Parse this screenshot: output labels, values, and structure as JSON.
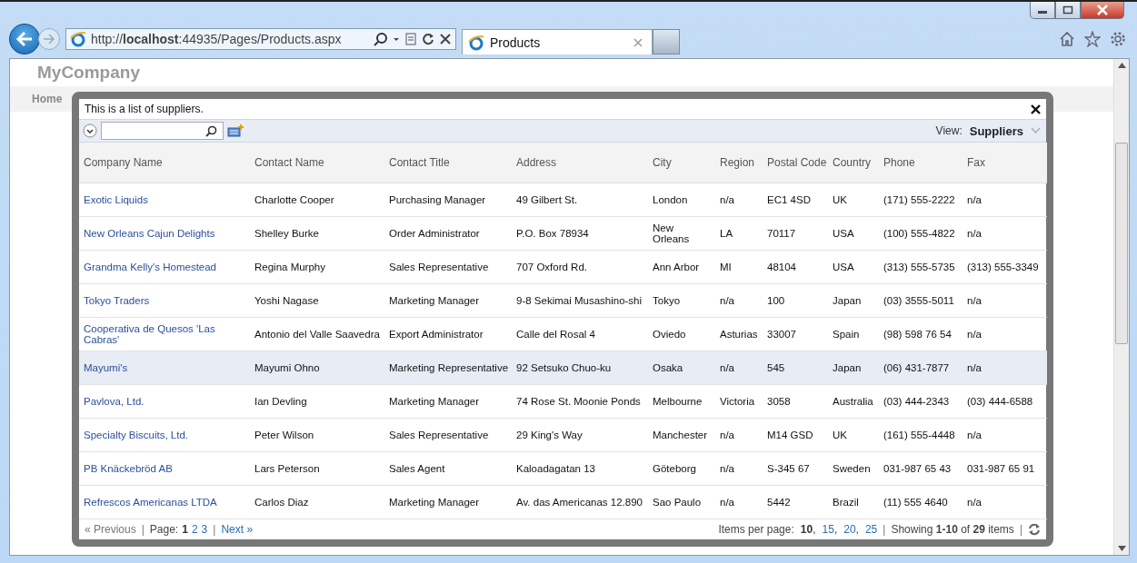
{
  "browser": {
    "address": "http://**localhost**:44935/Pages/Products.aspx",
    "tab": {
      "title": "Products",
      "selected": true
    }
  },
  "page": {
    "brand": "MyCompany",
    "nav": "Home"
  },
  "modal": {
    "description": "This is a list of suppliers.",
    "view": {
      "label": "View:",
      "value": "Suppliers"
    },
    "columns": [
      "Company Name",
      "Contact Name",
      "Contact Title",
      "Address",
      "City",
      "Region",
      "Postal Code",
      "Country",
      "Phone",
      "Fax"
    ],
    "rows": [
      {
        "selected": false,
        "cells": [
          "Exotic Liquids",
          "Charlotte Cooper",
          "Purchasing Manager",
          "49 Gilbert St.",
          "London",
          "n/a",
          "EC1 4SD",
          "UK",
          "(171) 555-2222",
          "n/a"
        ]
      },
      {
        "selected": false,
        "cells": [
          "New Orleans Cajun Delights",
          "Shelley Burke",
          "Order Administrator",
          "P.O. Box 78934",
          "New Orleans",
          "LA",
          "70117",
          "USA",
          "(100) 555-4822",
          "n/a"
        ]
      },
      {
        "selected": false,
        "cells": [
          "Grandma Kelly's Homestead",
          "Regina Murphy",
          "Sales Representative",
          "707 Oxford Rd.",
          "Ann Arbor",
          "MI",
          "48104",
          "USA",
          "(313) 555-5735",
          "(313) 555-3349"
        ]
      },
      {
        "selected": false,
        "cells": [
          "Tokyo Traders",
          "Yoshi Nagase",
          "Marketing Manager",
          "9-8 Sekimai Musashino-shi",
          "Tokyo",
          "n/a",
          "100",
          "Japan",
          "(03) 3555-5011",
          "n/a"
        ]
      },
      {
        "selected": false,
        "cells": [
          "Cooperativa de Quesos 'Las Cabras'",
          "Antonio del Valle Saavedra",
          "Export Administrator",
          "Calle del Rosal 4",
          "Oviedo",
          "Asturias",
          "33007",
          "Spain",
          "(98) 598 76 54",
          "n/a"
        ]
      },
      {
        "selected": true,
        "cells": [
          "Mayumi's",
          "Mayumi Ohno",
          "Marketing Representative",
          "92 Setsuko Chuo-ku",
          "Osaka",
          "n/a",
          "545",
          "Japan",
          "(06) 431-7877",
          "n/a"
        ]
      },
      {
        "selected": false,
        "cells": [
          "Pavlova, Ltd.",
          "Ian Devling",
          "Marketing Manager",
          "74 Rose St. Moonie Ponds",
          "Melbourne",
          "Victoria",
          "3058",
          "Australia",
          "(03) 444-2343",
          "(03) 444-6588"
        ]
      },
      {
        "selected": false,
        "cells": [
          "Specialty Biscuits, Ltd.",
          "Peter Wilson",
          "Sales Representative",
          "29 King's Way",
          "Manchester",
          "n/a",
          "M14 GSD",
          "UK",
          "(161) 555-4448",
          "n/a"
        ]
      },
      {
        "selected": false,
        "cells": [
          "PB Knäckebröd AB",
          "Lars Peterson",
          "Sales Agent",
          "Kaloadagatan 13",
          "Göteborg",
          "n/a",
          "S-345 67",
          "Sweden",
          "031-987 65 43",
          "031-987 65 91"
        ]
      },
      {
        "selected": false,
        "cells": [
          "Refrescos Americanas LTDA",
          "Carlos Diaz",
          "Marketing Manager",
          "Av. das Americanas 12.890",
          "Sao Paulo",
          "n/a",
          "5442",
          "Brazil",
          "(11) 555 4640",
          "n/a"
        ]
      }
    ],
    "pager": {
      "separator": "|",
      "list_separator": ",",
      "previous": "« Previous",
      "page_label": "Page:",
      "pages": [
        {
          "label": "1",
          "selected": true
        },
        {
          "label": "2",
          "selected": false
        },
        {
          "label": "3",
          "selected": false
        }
      ],
      "next": "Next »",
      "items_label": "Items per page:",
      "sizes": [
        {
          "label": "10",
          "selected": true
        },
        {
          "label": "15",
          "selected": false
        },
        {
          "label": "20",
          "selected": false
        },
        {
          "label": "25",
          "selected": false
        }
      ],
      "showing": "Showing **1-10** of **29** items"
    }
  }
}
